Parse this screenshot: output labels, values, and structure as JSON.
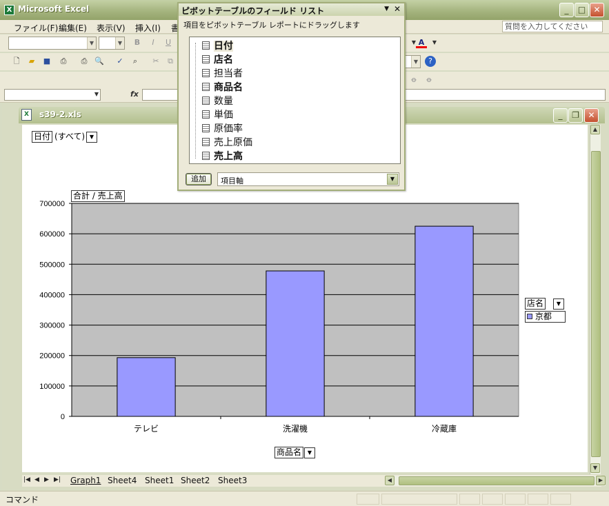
{
  "app": {
    "title": "Microsoft Excel"
  },
  "menu": {
    "items": [
      "ファイル(F)",
      "編集(E)",
      "表示(V)",
      "挿入(I)",
      "書"
    ],
    "help_placeholder": "質問を入力してください"
  },
  "workbook": {
    "title": "s39-2.xls"
  },
  "sheets": {
    "tabs": [
      "Graph1",
      "Sheet4",
      "Sheet1",
      "Sheet2",
      "Sheet3"
    ],
    "active": "Graph1"
  },
  "status": {
    "text": "コマンド"
  },
  "pivot_field_list": {
    "title": "ピボットテーブルのフィールド リスト",
    "description": "項目をピボットテーブル レポートにドラッグします",
    "fields": [
      {
        "label": "日付",
        "bold": true
      },
      {
        "label": "店名",
        "bold": true
      },
      {
        "label": "担当者",
        "bold": false
      },
      {
        "label": "商品名",
        "bold": true
      },
      {
        "label": "数量",
        "bold": false
      },
      {
        "label": "単価",
        "bold": false
      },
      {
        "label": "原価率",
        "bold": false
      },
      {
        "label": "売上原価",
        "bold": false
      },
      {
        "label": "売上高",
        "bold": true
      }
    ],
    "add_button": "追加",
    "area_selected": "項目軸"
  },
  "chart_fields": {
    "page_field": "日付",
    "page_value": "(すべて)",
    "data_field": "合計 / 売上高",
    "category_field": "商品名",
    "series_field": "店名",
    "legend_entry": "京都"
  },
  "chart_data": {
    "type": "bar",
    "categories": [
      "テレビ",
      "洗濯機",
      "冷蔵庫"
    ],
    "series": [
      {
        "name": "京都",
        "values": [
          193000,
          478000,
          625000
        ],
        "color": "#9999ff"
      }
    ],
    "ylim": [
      0,
      700000
    ],
    "yticks": [
      0,
      100000,
      200000,
      300000,
      400000,
      500000,
      600000,
      700000
    ],
    "plot_background": "#c0c0c0",
    "grid": true,
    "legend_position": "right"
  }
}
